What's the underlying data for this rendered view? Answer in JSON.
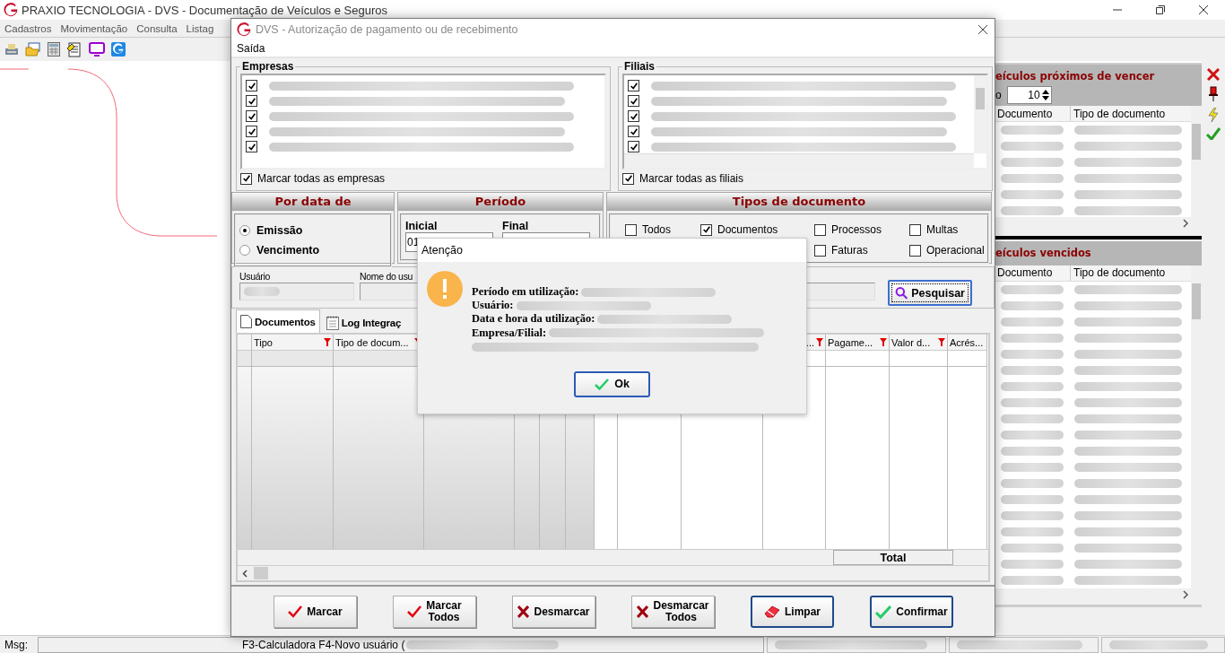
{
  "app": {
    "title": "PRAXIO TECNOLOGIA - DVS - Documentação de Veículos e Seguros",
    "menu": [
      "Cadastros",
      "Movimentação",
      "Consulta",
      "Listag"
    ]
  },
  "right_panel": {
    "upcoming": {
      "title": "eículos próximos de vencer",
      "days_label": "o",
      "days_value": "10",
      "columns": [
        "Documento",
        "Tipo de documento"
      ]
    },
    "expired": {
      "title": "eículos vencidos",
      "columns": [
        "Documento",
        "Tipo de documento"
      ]
    }
  },
  "status_bar": {
    "label": "Msg:",
    "hint": "F3-Calculadora F4-Novo usuário ("
  },
  "dialog": {
    "title": "DVS - Autorização de pagamento ou de recebimento",
    "menu": [
      "Saída"
    ],
    "empresas": {
      "title": "Empresas",
      "items": [
        {
          "checked": true
        },
        {
          "checked": true
        },
        {
          "checked": true
        },
        {
          "checked": true
        },
        {
          "checked": true
        }
      ],
      "select_all": {
        "label": "Marcar todas as empresas",
        "checked": true
      }
    },
    "filiais": {
      "title": "Filiais",
      "items": [
        {
          "checked": true
        },
        {
          "checked": true
        },
        {
          "checked": true
        },
        {
          "checked": true
        },
        {
          "checked": true
        }
      ],
      "select_all": {
        "label": "Marcar todas as filiais",
        "checked": true
      }
    },
    "date_basis": {
      "title": "Por data de",
      "options": [
        {
          "label": "Emissão",
          "selected": true
        },
        {
          "label": "Vencimento",
          "selected": false
        }
      ]
    },
    "period": {
      "title": "Período",
      "fields": [
        {
          "label": "Inicial",
          "value": "01"
        },
        {
          "label": "Final"
        }
      ]
    },
    "doc_types": {
      "title": "Tipos de documento",
      "options": [
        {
          "label": "Todos",
          "checked": false
        },
        {
          "label": "Documentos",
          "checked": true
        },
        {
          "label": "Processos",
          "checked": false
        },
        {
          "label": "Multas",
          "checked": false
        },
        {
          "label": "Faturas",
          "checked": false
        },
        {
          "label": "Operacional",
          "checked": false
        }
      ]
    },
    "user_label": "Usuário",
    "user_name_label": "Nome do usu",
    "search_button": "Pesquisar",
    "tabs": [
      {
        "label": "Documentos",
        "selected": true
      },
      {
        "label": "Log Integraç",
        "selected": false
      }
    ],
    "grid": {
      "columns": [
        {
          "label": "Tipo",
          "filter": true
        },
        {
          "label": "Tipo de docum...",
          "filter": true
        },
        {
          "label": "...",
          "filter": true
        },
        {
          "label": "Pagame...",
          "filter": true
        },
        {
          "label": "Valor d...",
          "filter": true
        },
        {
          "label": "Acrés...",
          "filter": false
        }
      ],
      "footer": "Total"
    },
    "buttons": [
      {
        "lines": [
          "Marcar"
        ],
        "kind": "check",
        "highlighted": false
      },
      {
        "lines": [
          "Marcar",
          "Todos"
        ],
        "kind": "check",
        "highlighted": false
      },
      {
        "lines": [
          "Desmarcar"
        ],
        "kind": "cross",
        "highlighted": false
      },
      {
        "lines": [
          "Desmarcar",
          "Todos"
        ],
        "kind": "cross",
        "highlighted": false
      },
      {
        "lines": [
          "Limpar"
        ],
        "kind": "eraser",
        "highlighted": true
      },
      {
        "lines": [
          "Confirmar"
        ],
        "kind": "confirm",
        "highlighted": true
      }
    ]
  },
  "alert": {
    "title": "Atenção",
    "lines": [
      {
        "label": "Período em utilização:"
      },
      {
        "label": "Usuário:"
      },
      {
        "label": "Data e hora da utilização:"
      },
      {
        "label": "Empresa/Filial:"
      }
    ],
    "button": "Ok"
  }
}
